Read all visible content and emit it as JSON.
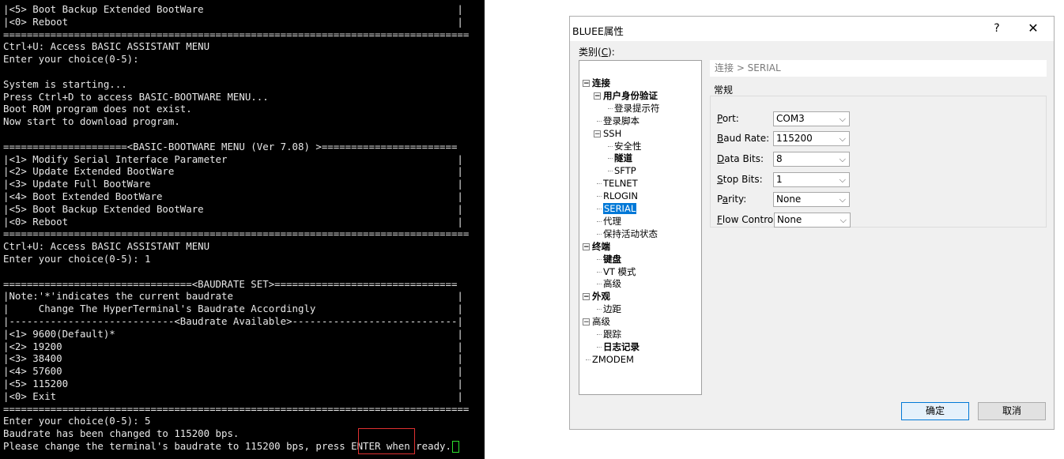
{
  "terminal": {
    "lines": [
      "|<5> Boot Backup Extended BootWare                                           |",
      "|<0> Reboot                                                                  |",
      "===============================================================================",
      "Ctrl+U: Access BASIC ASSISTANT MENU",
      "Enter your choice(0-5):",
      "",
      "System is starting...",
      "Press Ctrl+D to access BASIC-BOOTWARE MENU...",
      "Boot ROM program does not exist.",
      "Now start to download program.",
      "",
      "=====================<BASIC-BOOTWARE MENU (Ver 7.08) >=======================",
      "|<1> Modify Serial Interface Parameter                                       |",
      "|<2> Update Extended BootWare                                                |",
      "|<3> Update Full BootWare                                                    |",
      "|<4> Boot Extended BootWare                                                  |",
      "|<5> Boot Backup Extended BootWare                                           |",
      "|<0> Reboot                                                                  |",
      "===============================================================================",
      "Ctrl+U: Access BASIC ASSISTANT MENU",
      "Enter your choice(0-5): 1",
      "",
      "================================<BAUDRATE SET>===============================",
      "|Note:'*'indicates the current baudrate                                      |",
      "|     Change The HyperTerminal's Baudrate Accordingly                        |",
      "|----------------------------<Baudrate Available>----------------------------|",
      "|<1> 9600(Default)*                                                          |",
      "|<2> 19200                                                                   |",
      "|<3> 38400                                                                   |",
      "|<4> 57600                                                                   |",
      "|<5> 115200                                                                  |",
      "|<0> Exit                                                                    |",
      "===============================================================================",
      "Enter your choice(0-5): 5",
      "Baudrate has been changed to 115200 bps.",
      "Please change the terminal's baudrate to 115200 bps, press ENTER when ready."
    ],
    "cursor_color": "#2ee02e",
    "highlight_color": "#e03131"
  },
  "dialog": {
    "title": "BLUEE属性",
    "help_label": "?",
    "close_label": "✕",
    "category_label_prefix": "类别(",
    "category_label_key": "C",
    "category_label_suffix": "):",
    "tree": [
      {
        "label": "连接",
        "level": 0,
        "bold": true,
        "expander": "−"
      },
      {
        "label": "用户身份验证",
        "level": 1,
        "bold": true,
        "expander": "−"
      },
      {
        "label": "登录提示符",
        "level": 2,
        "bold": false
      },
      {
        "label": "登录脚本",
        "level": 1,
        "bold": false
      },
      {
        "label": "SSH",
        "level": 1,
        "bold": false,
        "expander": "−"
      },
      {
        "label": "安全性",
        "level": 2,
        "bold": false
      },
      {
        "label": "隧道",
        "level": 2,
        "bold": true
      },
      {
        "label": "SFTP",
        "level": 2,
        "bold": false
      },
      {
        "label": "TELNET",
        "level": 1,
        "bold": false
      },
      {
        "label": "RLOGIN",
        "level": 1,
        "bold": false
      },
      {
        "label": "SERIAL",
        "level": 1,
        "bold": false,
        "selected": true
      },
      {
        "label": "代理",
        "level": 1,
        "bold": false
      },
      {
        "label": "保持活动状态",
        "level": 1,
        "bold": false
      },
      {
        "label": "终端",
        "level": 0,
        "bold": true,
        "expander": "−"
      },
      {
        "label": "键盘",
        "level": 1,
        "bold": true
      },
      {
        "label": "VT 模式",
        "level": 1,
        "bold": false
      },
      {
        "label": "高级",
        "level": 1,
        "bold": false
      },
      {
        "label": "外观",
        "level": 0,
        "bold": true,
        "expander": "−"
      },
      {
        "label": "边距",
        "level": 1,
        "bold": false
      },
      {
        "label": "高级",
        "level": 0,
        "bold": false,
        "expander": "−"
      },
      {
        "label": "跟踪",
        "level": 1,
        "bold": false
      },
      {
        "label": "日志记录",
        "level": 1,
        "bold": true
      },
      {
        "label": "ZMODEM",
        "level": 0,
        "bold": false
      }
    ],
    "breadcrumb": "连接 > SERIAL",
    "group_title": "常规",
    "fields": [
      {
        "key": "P",
        "rest": "ort:",
        "value": "COM3"
      },
      {
        "key": "B",
        "rest": "aud Rate:",
        "value": "115200"
      },
      {
        "key": "D",
        "rest": "ata Bits:",
        "value": "8"
      },
      {
        "key": "S",
        "rest": "top Bits:",
        "value": "1"
      },
      {
        "key": "",
        "pre": "P",
        "key2": "a",
        "rest": "rity:",
        "value": "None"
      },
      {
        "key": "F",
        "rest": "low Control:",
        "value": "None"
      }
    ],
    "ok_label": "确定",
    "cancel_label": "取消",
    "accent_color": "#0078d7"
  }
}
